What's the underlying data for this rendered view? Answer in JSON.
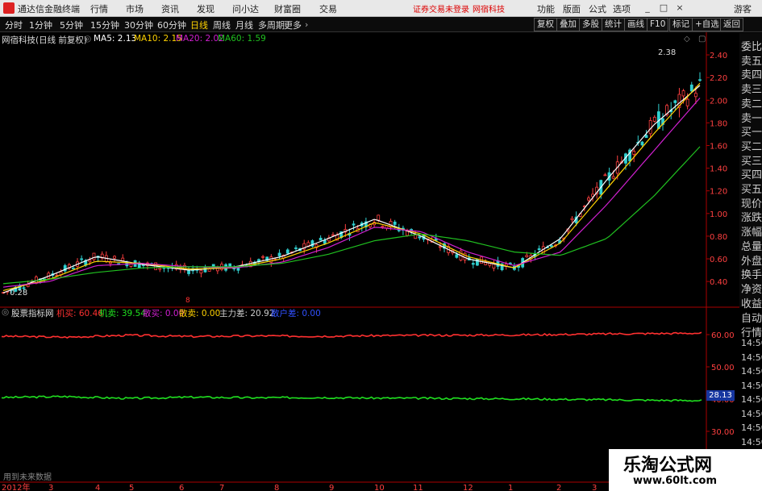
{
  "app": {
    "name": "通达信金融终端",
    "menu": [
      "行情",
      "市场",
      "资讯",
      "发现",
      "问小达",
      "财富圈",
      "交易"
    ],
    "notice": [
      "证券交易未登录",
      "网宿科技"
    ],
    "right_menu": [
      "功能",
      "版面",
      "公式",
      "选项"
    ],
    "window_buttons": [
      "_",
      "□",
      "×"
    ],
    "guest": "游客"
  },
  "period_tabs": [
    "分时",
    "1分钟",
    "5分钟",
    "15分钟",
    "30分钟",
    "60分钟",
    "日线",
    "周线",
    "月线",
    "多周期",
    "更多"
  ],
  "active_period": "日线",
  "tools": [
    "复权",
    "叠加",
    "多股",
    "统计",
    "画线",
    "F10",
    "标记",
    "+自选",
    "返回"
  ],
  "main_chart": {
    "stock": "网宿科技(日线 前复权)",
    "ma": [
      {
        "label": "MA5: 2.13",
        "color": "#ffffff"
      },
      {
        "label": "MA10: 2.15",
        "color": "#ffd200"
      },
      {
        "label": "MA20: 2.02",
        "color": "#d020d0"
      },
      {
        "label": "MA60: 1.59",
        "color": "#20c020"
      }
    ],
    "high_label": "2.38",
    "low_label": "0.28",
    "marker": "8"
  },
  "indicator": {
    "name": "股票指标网",
    "items": [
      {
        "label": "机买: 60.46",
        "color": "#ff3030"
      },
      {
        "label": "机卖: 39.54",
        "color": "#20e020"
      },
      {
        "label": "散买: 0.00",
        "color": "#d020d0"
      },
      {
        "label": "散卖: 0.00",
        "color": "#ffd200"
      },
      {
        "label": "主力差: 20.92",
        "color": "#cccccc"
      },
      {
        "label": "散户差: 0.00",
        "color": "#3050ff"
      }
    ],
    "value_box": "28.13",
    "footer": "用到未来数据"
  },
  "right_panel": [
    "委比",
    "卖五",
    "卖四",
    "卖三",
    "卖二",
    "卖一",
    "买一",
    "买二",
    "买三",
    "买四",
    "买五",
    "现价",
    "涨跌",
    "涨幅",
    "总量",
    "外盘",
    "换手",
    "净资",
    "收益"
  ],
  "right_panel_lower": [
    "自动",
    "行情",
    "14:50",
    "14:50",
    "14:50",
    "14:50",
    "14:50",
    "14:50",
    "14:50",
    "14:50",
    "14:50"
  ],
  "xaxis": [
    "2012年",
    "3",
    "4",
    "5",
    "6",
    "7",
    "8",
    "9",
    "10",
    "11",
    "12",
    "1",
    "2",
    "3"
  ],
  "watermark": {
    "title": "乐淘公式网",
    "url": "www.60lt.com"
  },
  "chart_data": [
    {
      "type": "line",
      "title": "网宿科技(日线 前复权)",
      "ylim": [
        0.28,
        2.5
      ],
      "y_ticks": [
        "2.40",
        "2.20",
        "2.00",
        "1.80",
        "1.60",
        "1.40",
        "1.20",
        "1.00",
        "0.80",
        "0.60",
        "0.40"
      ],
      "series": [
        {
          "name": "MA5",
          "color": "#ffffff",
          "values": [
            0.3,
            0.45,
            0.62,
            0.55,
            0.5,
            0.53,
            0.62,
            0.78,
            0.95,
            0.8,
            0.6,
            0.52,
            0.78,
            1.3,
            1.78,
            2.13
          ]
        },
        {
          "name": "MA10",
          "color": "#ffd200",
          "values": [
            0.32,
            0.42,
            0.58,
            0.56,
            0.51,
            0.52,
            0.6,
            0.74,
            0.92,
            0.82,
            0.62,
            0.52,
            0.74,
            1.22,
            1.7,
            2.15
          ]
        },
        {
          "name": "MA20",
          "color": "#d020d0",
          "values": [
            0.35,
            0.4,
            0.54,
            0.56,
            0.53,
            0.52,
            0.57,
            0.7,
            0.88,
            0.84,
            0.66,
            0.54,
            0.66,
            1.08,
            1.55,
            2.02
          ]
        },
        {
          "name": "MA60",
          "color": "#20c020",
          "values": [
            0.38,
            0.42,
            0.48,
            0.52,
            0.53,
            0.53,
            0.56,
            0.64,
            0.76,
            0.82,
            0.76,
            0.66,
            0.63,
            0.78,
            1.15,
            1.59
          ]
        }
      ]
    },
    {
      "type": "line",
      "title": "股票指标网",
      "ylim": [
        15,
        65
      ],
      "y_ticks": [
        "60.00",
        "50.00",
        "40.00",
        "30.00",
        "20.00"
      ],
      "series": [
        {
          "name": "机买",
          "color": "#ff3030",
          "values": [
            59.5,
            59.2,
            59.8,
            59.4,
            59.6,
            59.5,
            59.7,
            59.8,
            59.9,
            60.1,
            60.3,
            60.46
          ]
        },
        {
          "name": "机卖",
          "color": "#20e020",
          "values": [
            40.5,
            40.8,
            40.2,
            40.6,
            40.4,
            40.5,
            40.3,
            40.2,
            40.1,
            39.9,
            39.7,
            39.54
          ]
        }
      ]
    }
  ]
}
